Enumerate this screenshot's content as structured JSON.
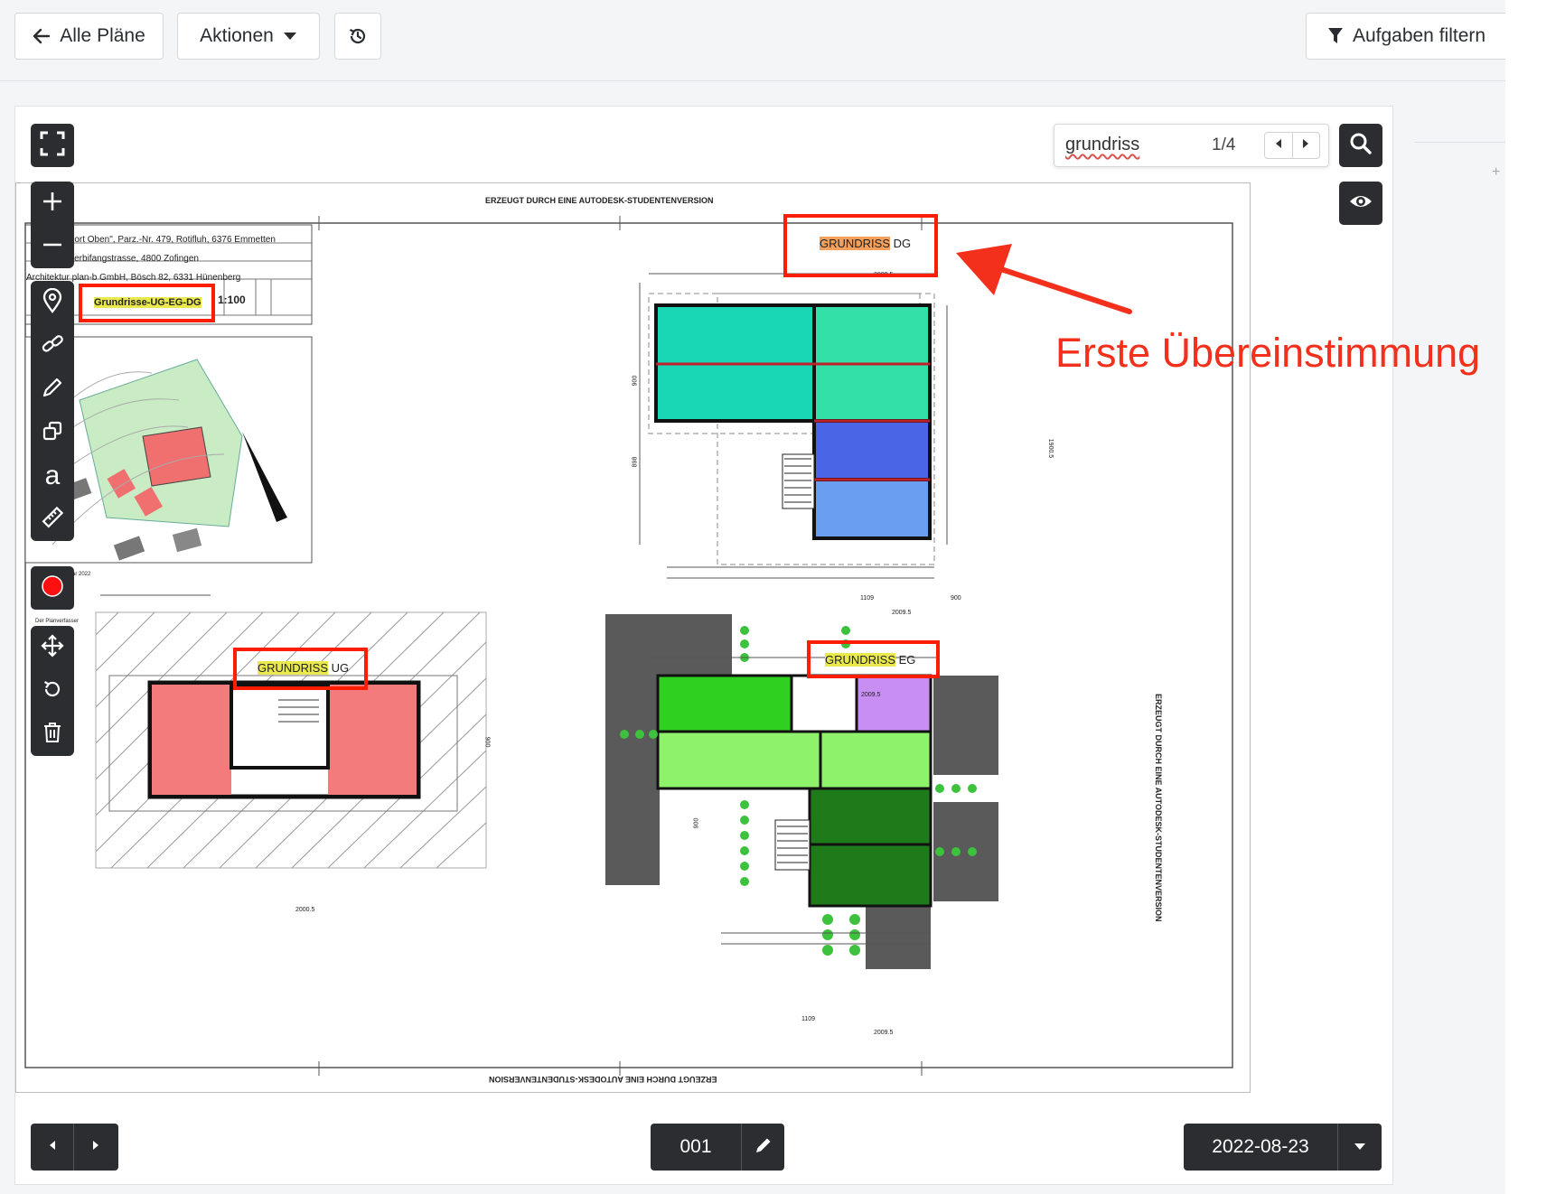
{
  "toolbar": {
    "back_label": "Alle Pläne",
    "actions_label": "Aktionen",
    "filter_label": "Aufgaben filtern"
  },
  "search": {
    "query": "grundriss",
    "match_count": "1/4"
  },
  "drawing": {
    "header_top": "ERZEUGT DURCH EINE AUTODESK-STUDENTENVERSION",
    "header_bottom": "ERZEUGT DURCH EINE AUTODESK-STUDENTENVERSION",
    "header_side": "ERZEUGT DURCH EINE AUTODESK-STUDENTENVERSION",
    "title_block": {
      "project": "\"Resort Oben\", Parz.-Nr. 479, Rotifluh, 6376 Emmetten",
      "client": "Junkerbifangstrasse, 4800 Zofingen",
      "architect": "Architektur plan-b GmbH, Bösch 82, 6331 Hünenberg",
      "plan_name": "Grundrisse-UG-EG-DG",
      "scale": "1:100",
      "date_fragment": "Januar 2022",
      "signature_label": "Der Planverfasser"
    },
    "plans": [
      {
        "keyword": "GRUNDRISS",
        "suffix": "DG"
      },
      {
        "keyword": "GRUNDRISS",
        "suffix": "UG"
      },
      {
        "keyword": "GRUNDRISS",
        "suffix": "EG"
      }
    ],
    "dims": {
      "dg_width": "2009.5",
      "dg_left": "1109",
      "dg_right": "900",
      "dg_height": "1900.5",
      "dg_side": "900",
      "dg_side2": "898",
      "ug_width": "2000.5",
      "ug_side": "900",
      "eg_width": "2009.5",
      "eg_left": "1109",
      "eg_side": "900"
    }
  },
  "annotation": {
    "text": "Erste Übereinstimmung",
    "color": "#f2301b"
  },
  "footer": {
    "page_number": "001",
    "version_date": "2022-08-23"
  },
  "colors": {
    "accent_dark": "#2b2d30",
    "highlight_box": "#ff1d00",
    "search_highlight": "#e9e84d"
  },
  "icons": [
    "arrow-left-icon",
    "caret-down-icon",
    "history-icon",
    "filter-icon",
    "fullscreen-icon",
    "zoom-in-icon",
    "zoom-out-icon",
    "map-pin-icon",
    "link-icon",
    "pencil-icon",
    "shapes-icon",
    "text-icon",
    "ruler-icon",
    "record-icon",
    "move-icon",
    "rotate-icon",
    "trash-icon",
    "search-icon",
    "eye-icon",
    "caret-left-icon",
    "caret-right-icon",
    "edit-icon"
  ]
}
